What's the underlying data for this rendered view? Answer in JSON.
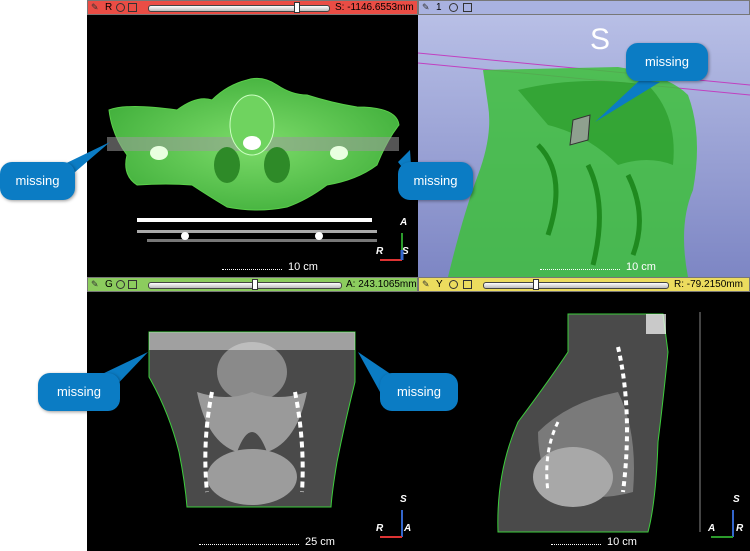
{
  "views": {
    "red": {
      "letter": "R",
      "readout": "S: -1146.6553mm",
      "scale": "10 cm",
      "slider_value": 0.82,
      "color": "#e8403a",
      "orient": [
        "A",
        "R",
        "S"
      ]
    },
    "three_d": {
      "letter": "1",
      "orient_letter": "S",
      "scale": "10 cm",
      "color": "#9aa6d6"
    },
    "green": {
      "letter": "G",
      "readout": "A: 243.1065mm",
      "scale": "25 cm",
      "slider_value": 0.55,
      "color": "#7cc04a",
      "orient": [
        "S",
        "R",
        "A"
      ]
    },
    "yellow": {
      "letter": "Y",
      "readout": "R: -79.2150mm",
      "scale": "10 cm",
      "slider_value": 0.28,
      "color": "#e9d94a",
      "orient": [
        "S",
        "A",
        "R"
      ]
    }
  },
  "callouts": [
    "missing",
    "missing",
    "missing",
    "missing",
    "missing",
    "missing"
  ],
  "icons": [
    "pin-icon",
    "crosshair-icon",
    "window-icon"
  ]
}
